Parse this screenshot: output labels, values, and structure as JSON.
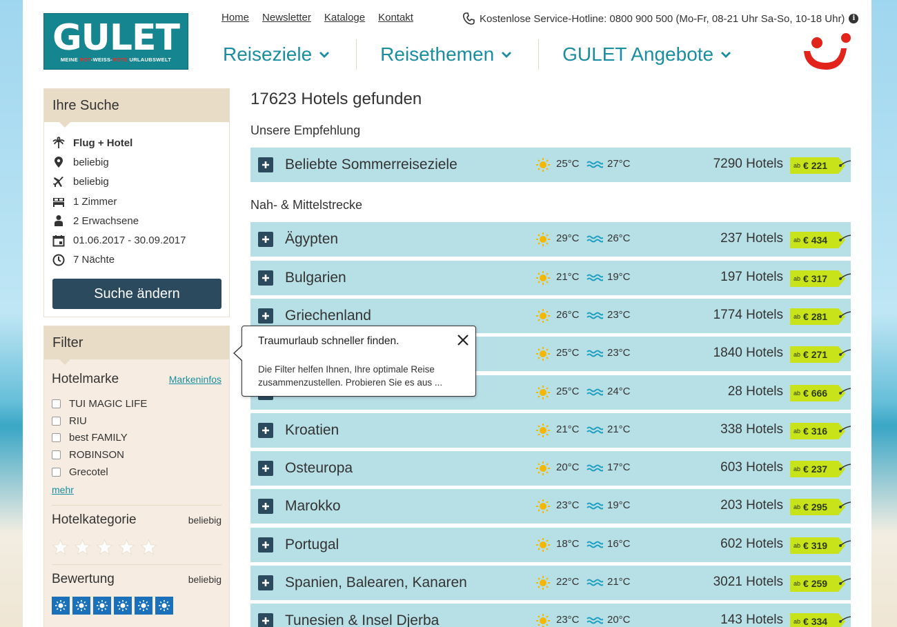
{
  "brand": {
    "logo_word": "GULET",
    "tagline_parts": [
      "MEINE ",
      "ROT",
      "-WEISS-",
      "ROTE",
      " URLAUBSWELT"
    ]
  },
  "topnav": [
    "Home",
    "Newsletter",
    "Kataloge",
    "Kontakt"
  ],
  "hotline": {
    "text": "Kostenlose Service-Hotline: 0800 900 500 (Mo-Fr, 08-21 Uhr Sa-So, 10-18 Uhr)",
    "info": "i"
  },
  "mainnav": [
    "Reiseziele",
    "Reisethemen",
    "GULET Angebote"
  ],
  "search": {
    "title": "Ihre Suche",
    "items": [
      {
        "icon": "palm-icon",
        "text": "Flug + Hotel"
      },
      {
        "icon": "location-pin-icon",
        "text": "beliebig"
      },
      {
        "icon": "plane-icon",
        "text": "beliebig"
      },
      {
        "icon": "bed-icon",
        "text": "1 Zimmer"
      },
      {
        "icon": "person-icon",
        "text": "2 Erwachsene"
      },
      {
        "icon": "calendar-icon",
        "text": "01.06.2017 - 30.09.2017"
      },
      {
        "icon": "clock-icon",
        "text": "7 Nächte"
      }
    ],
    "button": "Suche ändern"
  },
  "filter": {
    "title": "Filter",
    "brand": {
      "title": "Hotelmarke",
      "link": "Markeninfos",
      "options": [
        "TUI MAGIC LIFE",
        "RIU",
        "best FAMILY",
        "ROBINSON",
        "Grecotel"
      ],
      "more": "mehr"
    },
    "category": {
      "title": "Hotelkategorie",
      "value": "beliebig",
      "stars": 5
    },
    "rating": {
      "title": "Bewertung",
      "value": "beliebig",
      "suns": 6
    }
  },
  "results": {
    "title": "17623 Hotels gefunden",
    "sections": [
      {
        "label": "Unsere Empfehlung",
        "rows": [
          {
            "name": "Beliebte Sommerreiseziele",
            "air": "25°C",
            "water": "27°C",
            "hotels": "7290 Hotels",
            "price_prefix": "ab",
            "price": "€ 221"
          }
        ]
      },
      {
        "label": "Nah- & Mittelstrecke",
        "rows": [
          {
            "name": "Ägypten",
            "air": "29°C",
            "water": "26°C",
            "hotels": "237 Hotels",
            "price_prefix": "ab",
            "price": "€ 434"
          },
          {
            "name": "Bulgarien",
            "air": "21°C",
            "water": "19°C",
            "hotels": "197 Hotels",
            "price_prefix": "ab",
            "price": "€ 317"
          },
          {
            "name": "Griechenland",
            "air": "26°C",
            "water": "23°C",
            "hotels": "1774 Hotels",
            "price_prefix": "ab",
            "price": "€ 281"
          },
          {
            "name": "",
            "air": "25°C",
            "water": "23°C",
            "hotels": "1840 Hotels",
            "price_prefix": "ab",
            "price": "€ 271"
          },
          {
            "name": "",
            "air": "25°C",
            "water": "24°C",
            "hotels": "28 Hotels",
            "price_prefix": "ab",
            "price": "€ 666"
          },
          {
            "name": "Kroatien",
            "air": "21°C",
            "water": "21°C",
            "hotels": "338 Hotels",
            "price_prefix": "ab",
            "price": "€ 316"
          },
          {
            "name": "Osteuropa",
            "air": "20°C",
            "water": "17°C",
            "hotels": "603 Hotels",
            "price_prefix": "ab",
            "price": "€ 237"
          },
          {
            "name": "Marokko",
            "air": "23°C",
            "water": "19°C",
            "hotels": "203 Hotels",
            "price_prefix": "ab",
            "price": "€ 295"
          },
          {
            "name": "Portugal",
            "air": "18°C",
            "water": "16°C",
            "hotels": "602 Hotels",
            "price_prefix": "ab",
            "price": "€ 319"
          },
          {
            "name": "Spanien, Balearen, Kanaren",
            "air": "22°C",
            "water": "21°C",
            "hotels": "3021 Hotels",
            "price_prefix": "ab",
            "price": "€ 259"
          },
          {
            "name": "Tunesien & Insel Djerba",
            "air": "23°C",
            "water": "20°C",
            "hotels": "143 Hotels",
            "price_prefix": "ab",
            "price": "€ 334"
          }
        ]
      }
    ]
  },
  "popover": {
    "title": "Traumurlaub schneller finden.",
    "text": "Die Filter helfen Ihnen, Ihre optimale Reise zusammenzustellen. Probieren Sie es aus ..."
  },
  "colors": {
    "accent": "#1a8ea0",
    "row_bg": "#b7dfe6",
    "button": "#2b4a5e",
    "price_tag": "#c9e31b",
    "sun": "#f5b800",
    "wave": "#1d9fbf",
    "tui_red": "#e2231a"
  }
}
